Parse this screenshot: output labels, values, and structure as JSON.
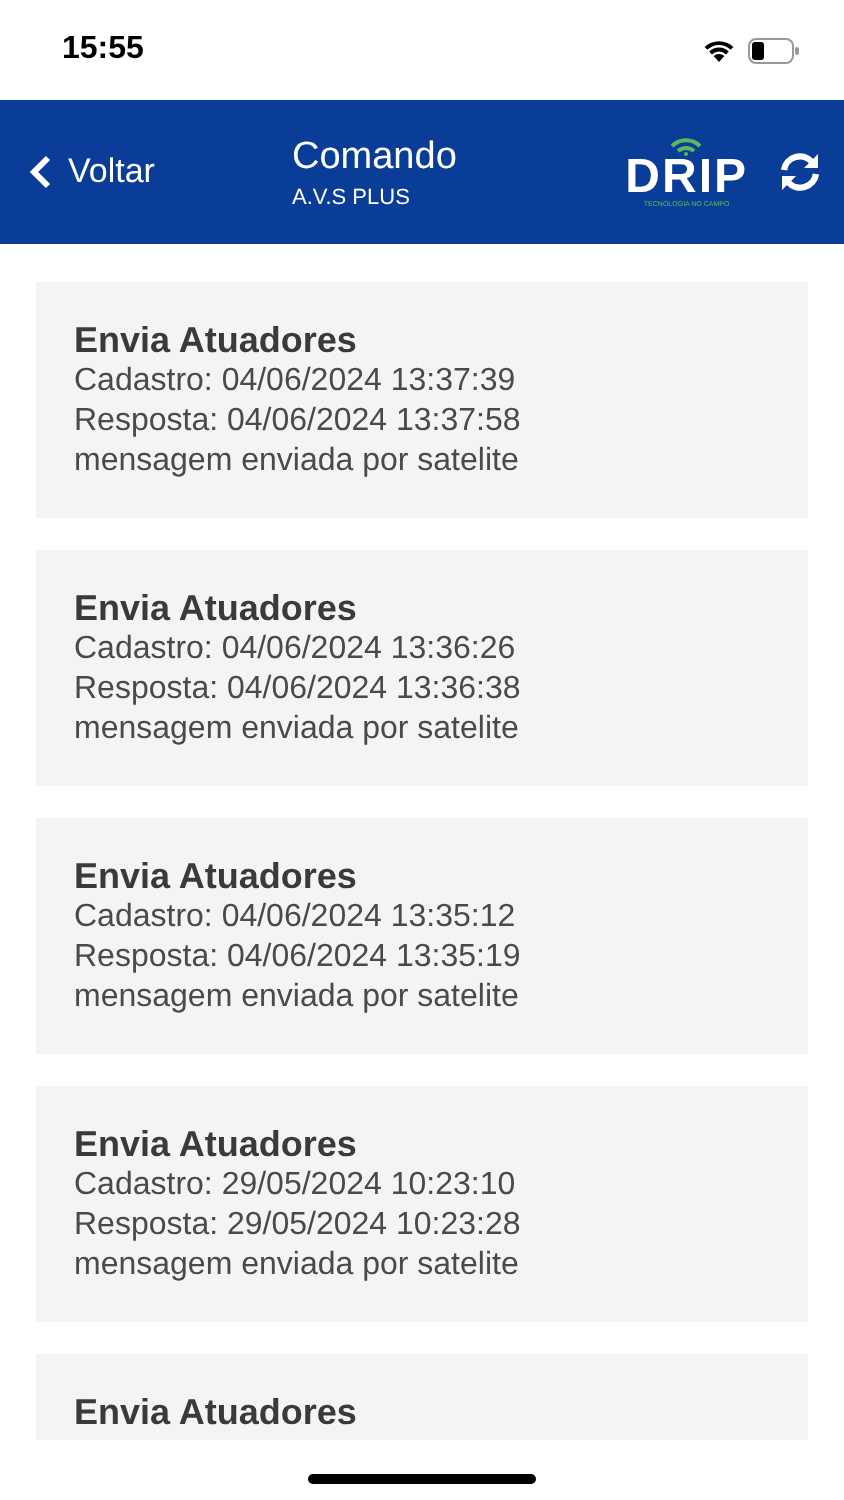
{
  "status_bar": {
    "time": "15:55"
  },
  "header": {
    "back": "Voltar",
    "title": "Comando",
    "subtitle": "A.V.S PLUS",
    "logo": {
      "name": "DRIP",
      "tagline": "TECNOLOGIA NO CAMPO"
    }
  },
  "commands": [
    {
      "title": "Envia Atuadores",
      "lines": [
        "Cadastro: 04/06/2024 13:37:39",
        "Resposta: 04/06/2024 13:37:58",
        "mensagem enviada por satelite"
      ]
    },
    {
      "title": "Envia Atuadores",
      "lines": [
        "Cadastro: 04/06/2024 13:36:26",
        "Resposta: 04/06/2024 13:36:38",
        "mensagem enviada por satelite"
      ]
    },
    {
      "title": "Envia Atuadores",
      "lines": [
        "Cadastro: 04/06/2024 13:35:12",
        "Resposta: 04/06/2024 13:35:19",
        "mensagem enviada por satelite"
      ]
    },
    {
      "title": "Envia Atuadores",
      "lines": [
        "Cadastro: 29/05/2024 10:23:10",
        "Resposta: 29/05/2024 10:23:28",
        "mensagem enviada por satelite"
      ]
    },
    {
      "title": "Envia Atuadores"
    }
  ]
}
